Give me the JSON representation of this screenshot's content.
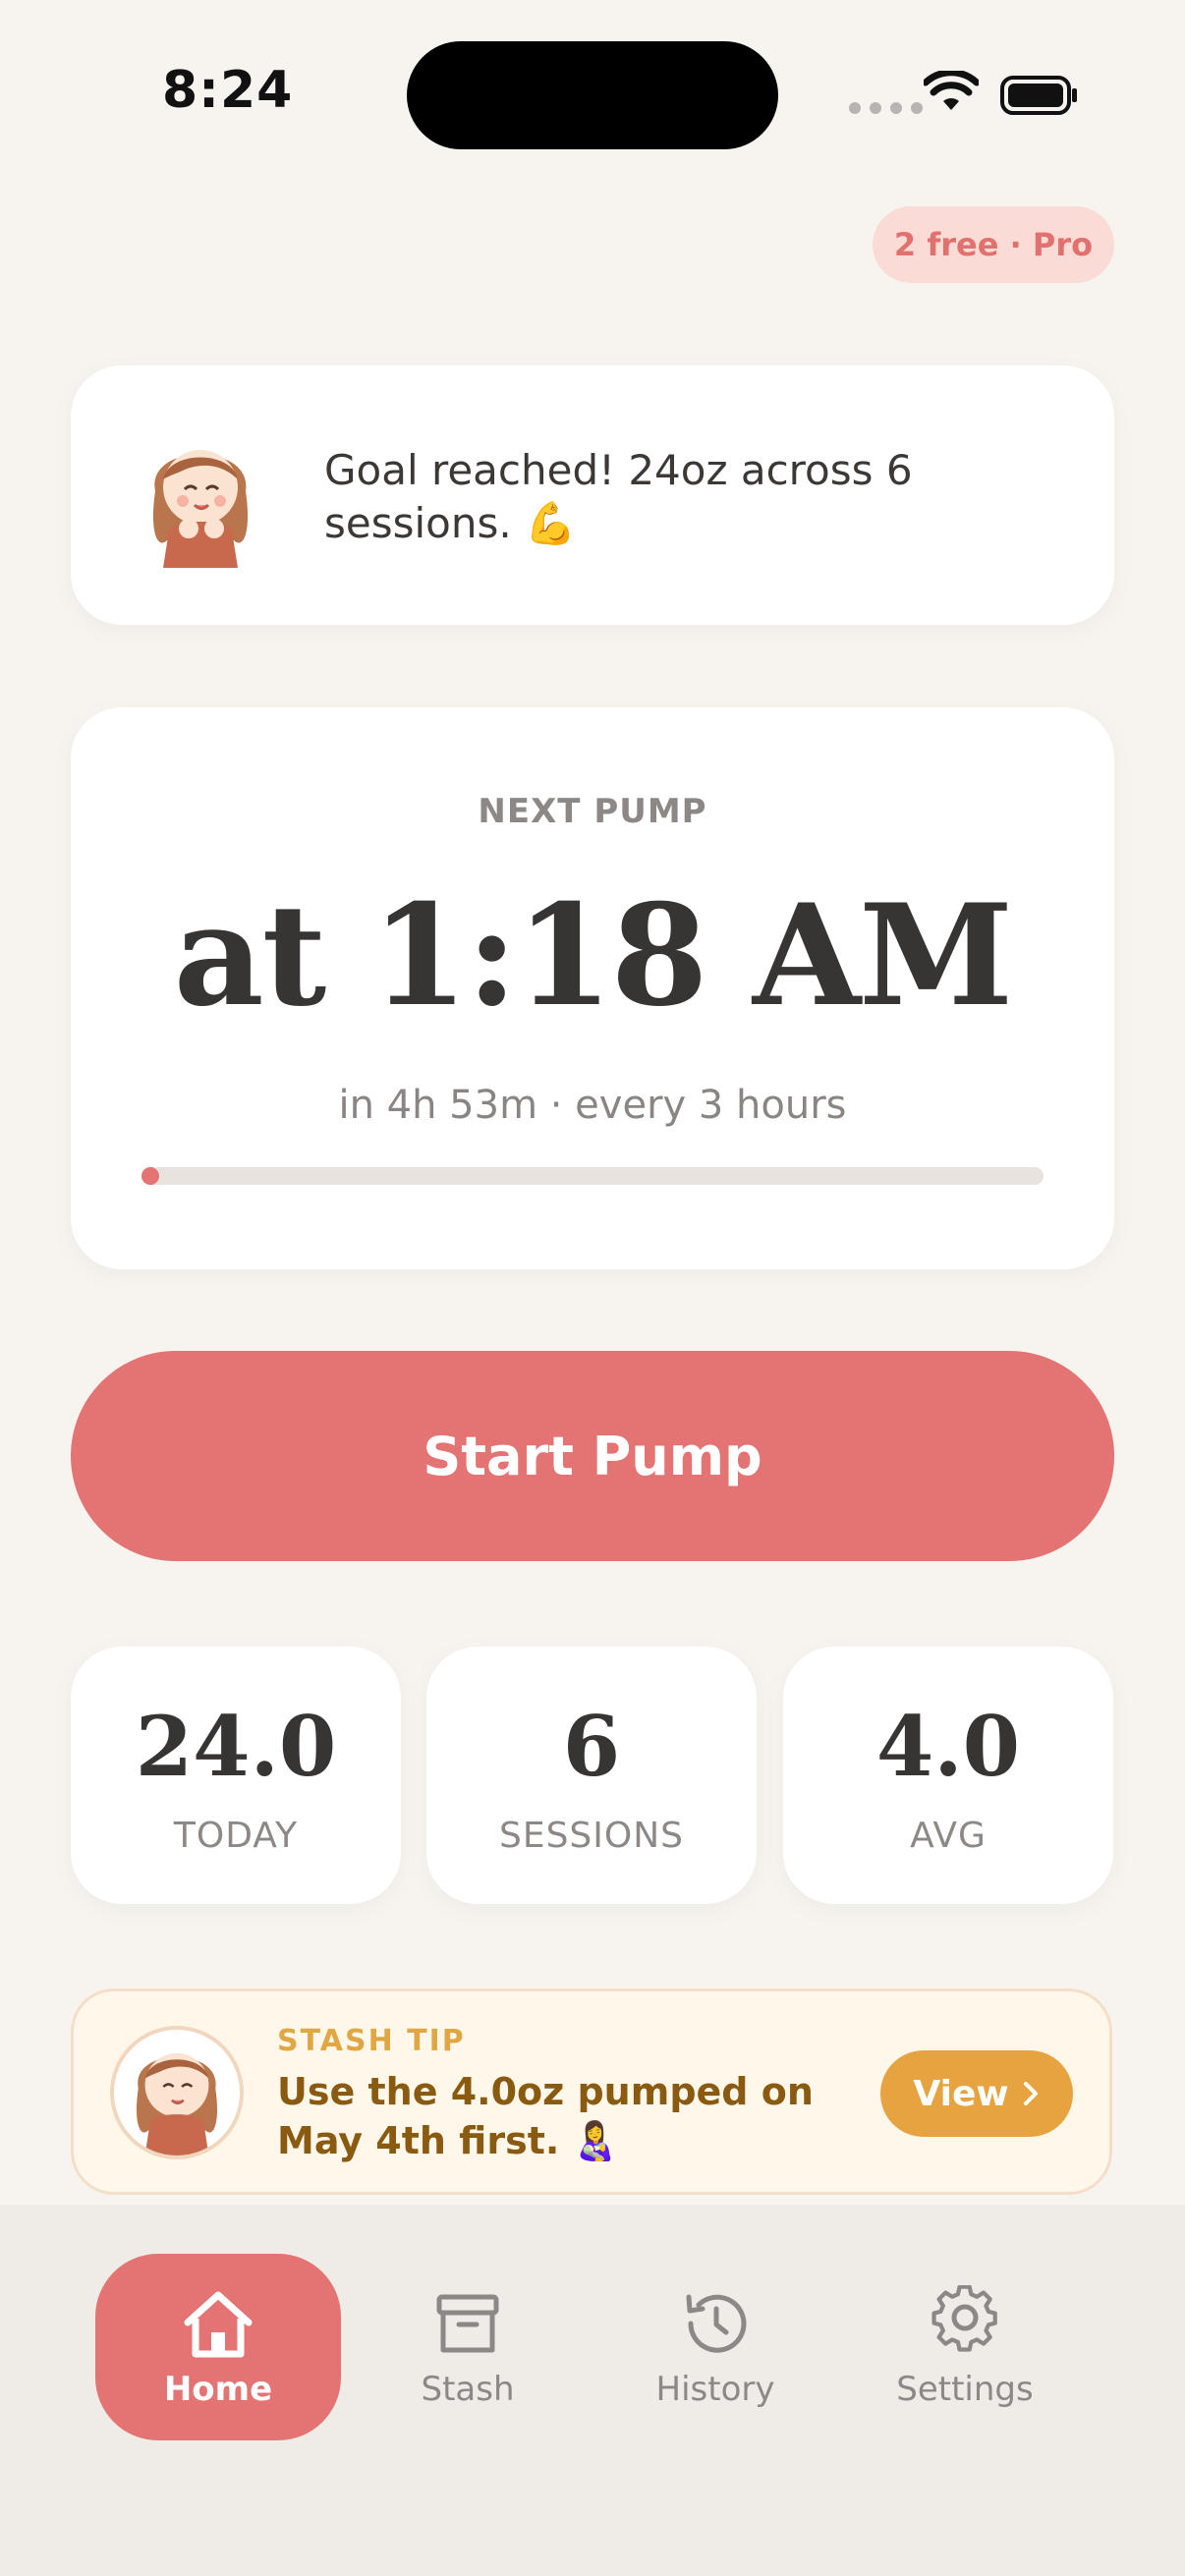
{
  "status_bar": {
    "time": "8:24"
  },
  "header": {
    "pro_badge": "2 free · Pro"
  },
  "message": {
    "text": "Goal reached! 24oz across 6 sessions. 💪"
  },
  "next_pump": {
    "label": "NEXT PUMP",
    "time": "at 1:18 AM",
    "subtitle": "in 4h 53m · every 3 hours",
    "progress": 0.02
  },
  "start_button": {
    "label": "Start Pump"
  },
  "stats": [
    {
      "value": "24.0",
      "label": "TODAY"
    },
    {
      "value": "6",
      "label": "SESSIONS"
    },
    {
      "value": "4.0",
      "label": "AVG"
    }
  ],
  "tip": {
    "label": "STASH TIP",
    "text": "Use the 4.0oz pumped on May 4th first. 👩‍🍼",
    "button": "View"
  },
  "tabs": [
    {
      "label": "Home",
      "icon": "home-icon",
      "active": true
    },
    {
      "label": "Stash",
      "icon": "archive-box-icon",
      "active": false
    },
    {
      "label": "History",
      "icon": "history-icon",
      "active": false
    },
    {
      "label": "Settings",
      "icon": "gear-icon",
      "active": false
    }
  ],
  "colors": {
    "accent": "#e47373",
    "tip_accent": "#e6a340",
    "background": "#f7f4f0"
  }
}
